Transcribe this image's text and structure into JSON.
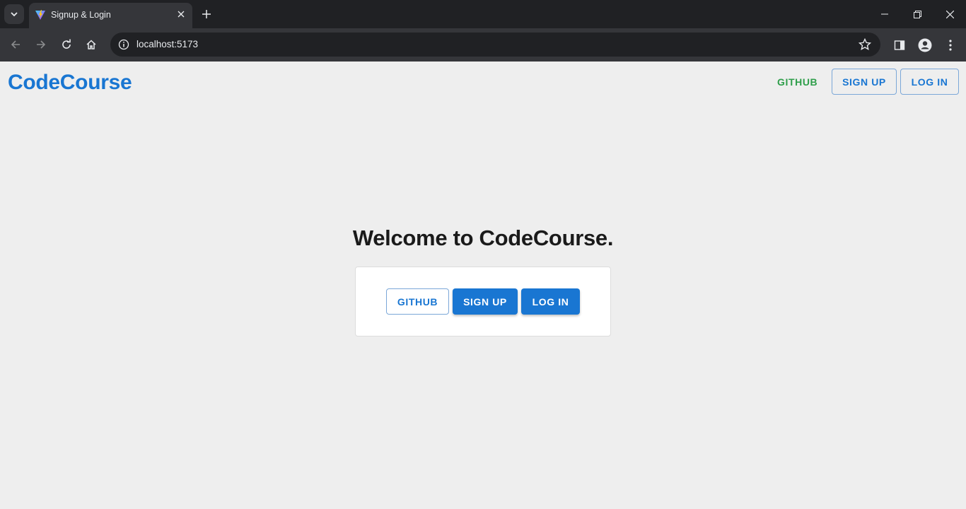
{
  "browser": {
    "tab_title": "Signup & Login",
    "url": "localhost:5173"
  },
  "header": {
    "brand": "CodeCourse",
    "nav_github": "GITHUB",
    "nav_signup": "SIGN UP",
    "nav_login": "LOG IN"
  },
  "main": {
    "heading": "Welcome to CodeCourse.",
    "github_button": "GITHUB",
    "signup_button": "SIGN UP",
    "login_button": "LOG IN"
  },
  "colors": {
    "primary": "#1976d2",
    "github_green": "#2e9e4a",
    "page_background": "#eeeeee"
  }
}
